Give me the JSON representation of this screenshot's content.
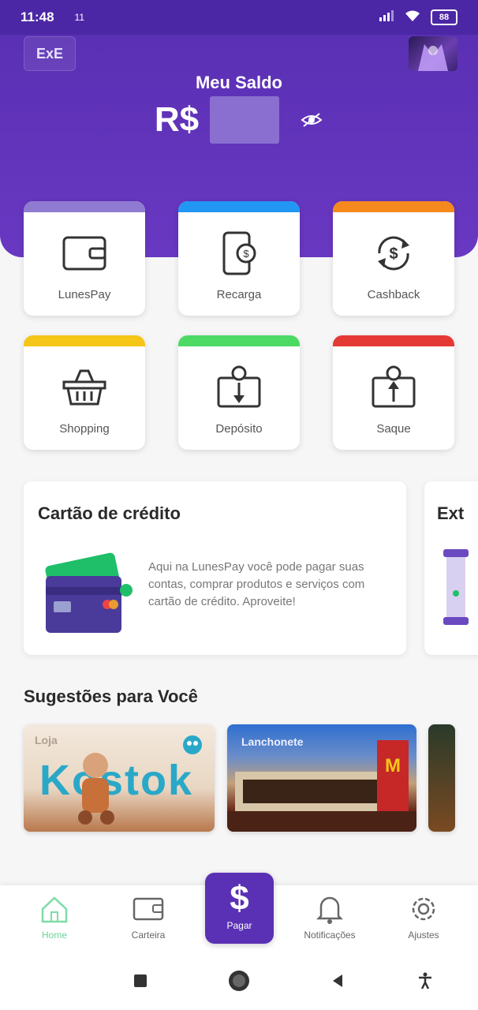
{
  "status_bar": {
    "time": "11:48",
    "extra": "11",
    "battery": "88"
  },
  "header": {
    "logo_text": "ExE",
    "balance_label": "Meu Saldo",
    "currency": "R$"
  },
  "tiles": [
    {
      "label": "LunesPay",
      "color": "#8f7bd1",
      "icon": "wallet-icon"
    },
    {
      "label": "Recarga",
      "color": "#2196f3",
      "icon": "phone-recharge-icon"
    },
    {
      "label": "Cashback",
      "color": "#f5891e",
      "icon": "cashback-icon"
    },
    {
      "label": "Shopping",
      "color": "#f5c518",
      "icon": "basket-icon"
    },
    {
      "label": "Depósito",
      "color": "#4cd964",
      "icon": "deposit-icon"
    },
    {
      "label": "Saque",
      "color": "#e53935",
      "icon": "withdraw-icon"
    }
  ],
  "credit": {
    "title": "Cartão de crédito",
    "text": "Aqui na LunesPay você pode pagar suas contas, comprar produtos e serviços com cartão de crédito. Aproveite!"
  },
  "extrato": {
    "title": "Ext"
  },
  "suggestions": {
    "title": "Sugestões para Você",
    "items": [
      {
        "store_label": "Loja",
        "brand": "Kostok"
      },
      {
        "label": "Lanchonete"
      },
      {
        "label": ""
      }
    ]
  },
  "bottom_nav": {
    "home": "Home",
    "wallet": "Carteira",
    "pay": "Pagar",
    "notifications": "Notificações",
    "settings": "Ajustes"
  },
  "colors": {
    "primary": "#5a30b4",
    "home_active": "#6ad49a"
  }
}
